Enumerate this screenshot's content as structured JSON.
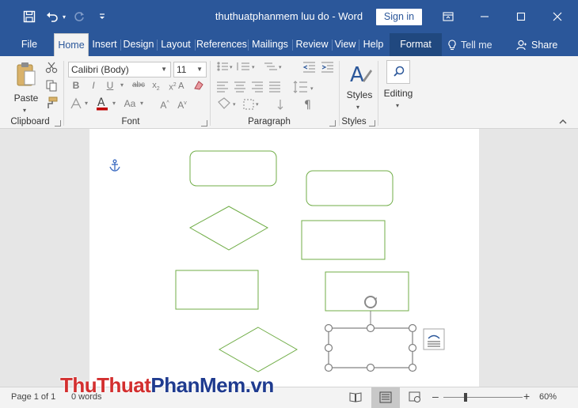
{
  "window": {
    "title": "thuthuatphanmem luu do  -  Word",
    "sign_in": "Sign in"
  },
  "tabs": [
    {
      "label": "File"
    },
    {
      "label": "Home"
    },
    {
      "label": "Insert"
    },
    {
      "label": "Design"
    },
    {
      "label": "Layout"
    },
    {
      "label": "References"
    },
    {
      "label": "Mailings"
    },
    {
      "label": "Review"
    },
    {
      "label": "View"
    },
    {
      "label": "Help"
    },
    {
      "label": "Format"
    }
  ],
  "tell_me": "Tell me",
  "share": "Share",
  "ribbon": {
    "clipboard": {
      "label": "Clipboard",
      "paste": "Paste"
    },
    "font": {
      "label": "Font",
      "font_name": "Calibri (Body)",
      "font_size": "11"
    },
    "paragraph": {
      "label": "Paragraph"
    },
    "styles": {
      "label": "Styles",
      "button": "Styles"
    },
    "editing": {
      "button": "Editing"
    }
  },
  "status": {
    "page": "Page 1 of 1",
    "words": "0 words",
    "zoom": "60%"
  },
  "watermark": {
    "part1": "ThuThuat",
    "part2": "PhanMem",
    "part3": ".vn"
  },
  "colors": {
    "title_bar": "#2b579a",
    "shape_stroke": "#70ad47",
    "font_color_underline": "#c00000"
  }
}
